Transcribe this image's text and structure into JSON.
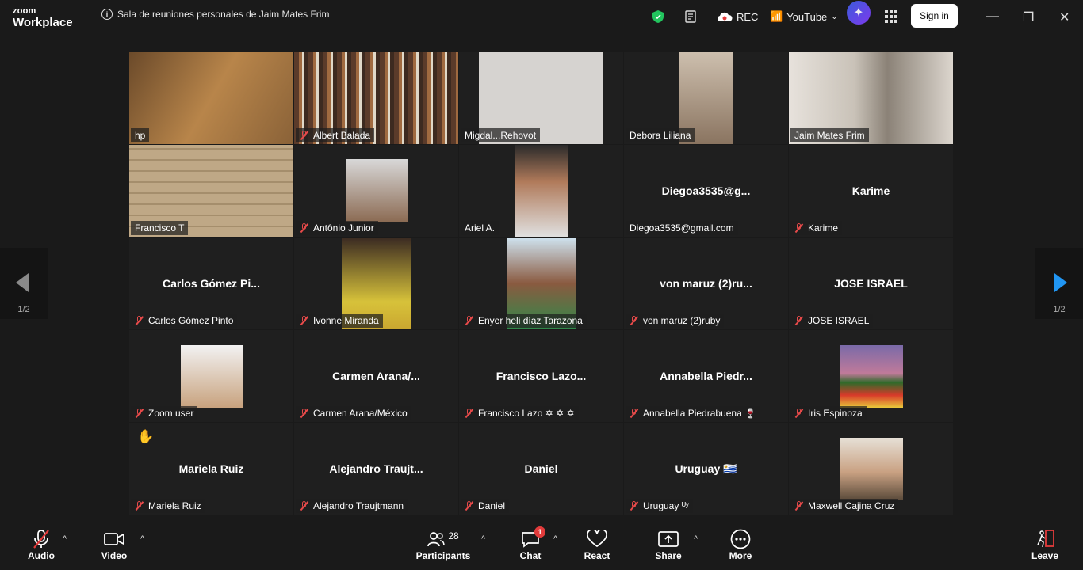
{
  "app": {
    "brand_top": "zoom",
    "brand_bottom": "Workplace",
    "meeting_title": "Sala de reuniones personales de Jaim Mates Frim"
  },
  "titlebar": {
    "rec_label": "REC",
    "youtube_label": "YouTube",
    "signin_label": "Sign in"
  },
  "pager": {
    "page": "1/2"
  },
  "tiles": [
    {
      "label": "hp",
      "big": "",
      "muted": false
    },
    {
      "label": "Albert Balada",
      "big": "",
      "muted": true
    },
    {
      "label": "Migdal...Rehovot",
      "big": "",
      "muted": false
    },
    {
      "label": "Debora Liliana",
      "big": "",
      "muted": false
    },
    {
      "label": "Jaim Mates Frim",
      "big": "",
      "muted": false
    },
    {
      "label": "Francisco T",
      "big": "",
      "muted": false
    },
    {
      "label": "Antônio Junior",
      "big": "",
      "muted": true
    },
    {
      "label": "Ariel A.",
      "big": "",
      "muted": false
    },
    {
      "label": "Diegoa3535@gmail.com",
      "big": "Diegoa3535@g...",
      "muted": false
    },
    {
      "label": "Karime",
      "big": "Karime",
      "muted": true
    },
    {
      "label": "Carlos Gómez Pinto",
      "big": "Carlos Gómez Pi...",
      "muted": true
    },
    {
      "label": "Ivonne Miranda",
      "big": "",
      "muted": true
    },
    {
      "label": "Enyer heli díaz Tarazona",
      "big": "",
      "muted": true
    },
    {
      "label": "von maruz (2)ruby",
      "big": "von maruz (2)ru...",
      "muted": true
    },
    {
      "label": "JOSE ISRAEL",
      "big": "JOSE ISRAEL",
      "muted": true
    },
    {
      "label": "Zoom user",
      "big": "",
      "muted": true
    },
    {
      "label": "Carmen Arana/México",
      "big": "Carmen Arana/...",
      "muted": true
    },
    {
      "label": "Francisco Lazo ✡ ✡ ✡",
      "big": "Francisco Lazo...",
      "muted": true
    },
    {
      "label": "Annabella Piedrabuena 🍷",
      "big": "Annabella  Piedr...",
      "muted": true
    },
    {
      "label": "Iris Espinoza",
      "big": "",
      "muted": true
    },
    {
      "label": "Mariela Ruiz",
      "big": "Mariela Ruiz",
      "muted": true
    },
    {
      "label": "Alejandro Traujtmann",
      "big": "Alejandro  Traujt...",
      "muted": true
    },
    {
      "label": "Daniel",
      "big": "Daniel",
      "muted": true
    },
    {
      "label": "Uruguay ᵁʸ",
      "big": "Uruguay 🇺🇾",
      "muted": true
    },
    {
      "label": "Maxwell Cajina Cruz",
      "big": "",
      "muted": true
    }
  ],
  "toolbar": {
    "audio": "Audio",
    "video": "Video",
    "participants": "Participants",
    "participants_count": "28",
    "chat": "Chat",
    "chat_badge": "1",
    "react": "React",
    "share": "Share",
    "more": "More",
    "leave": "Leave"
  },
  "colors": {
    "active_speaker": "#22c55e",
    "muted": "#e74a4a",
    "arrow_blue": "#2196f3"
  }
}
